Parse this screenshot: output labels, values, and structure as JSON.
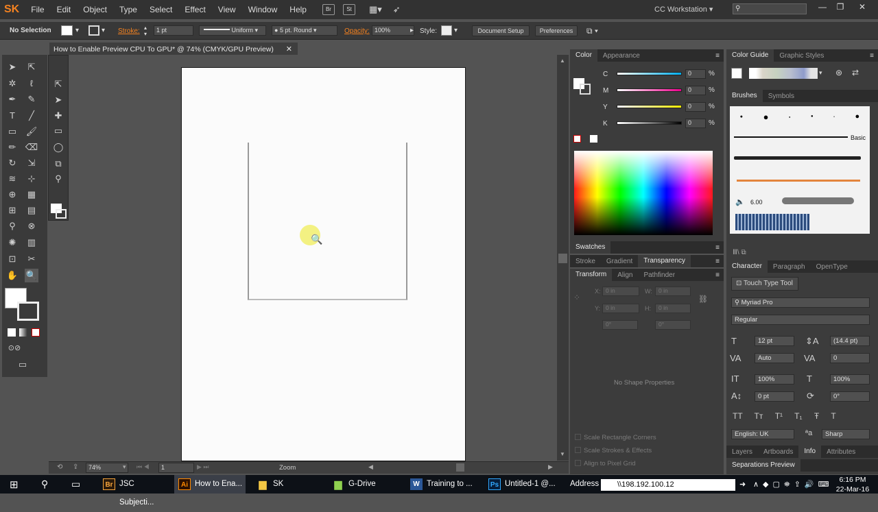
{
  "app": {
    "logo": "SK",
    "menu": [
      "File",
      "Edit",
      "Object",
      "Type",
      "Select",
      "Effect",
      "View",
      "Window",
      "Help"
    ],
    "bridge": "Br",
    "stock": "St",
    "workspace": "CC Workstation"
  },
  "control": {
    "selection": "No Selection",
    "stroke_label": "Stroke:",
    "stroke_weight": "1 pt",
    "profile": "Uniform",
    "brush": "5 pt. Round",
    "opacity_label": "Opacity:",
    "opacity": "100%",
    "style_label": "Style:",
    "doc_setup": "Document Setup",
    "preferences": "Preferences"
  },
  "document": {
    "tab_title": "How to Enable Preview CPU To GPU* @ 74% (CMYK/GPU Preview)",
    "zoom": "74%",
    "page": "1",
    "status": "Zoom"
  },
  "color_panel": {
    "tabs": [
      "Color",
      "Appearance"
    ],
    "channels": [
      {
        "name": "C",
        "value": "0"
      },
      {
        "name": "M",
        "value": "0"
      },
      {
        "name": "Y",
        "value": "0"
      },
      {
        "name": "K",
        "value": "0"
      }
    ],
    "pct": "%"
  },
  "swatches_panel": {
    "title": "Swatches"
  },
  "mid_tabs": [
    "Stroke",
    "Gradient",
    "Transparency"
  ],
  "transform_panel": {
    "tabs": [
      "Transform",
      "Align",
      "Pathfinder"
    ],
    "x_label": "X:",
    "x": "0 in",
    "w_label": "W:",
    "w": "0 in",
    "y_label": "Y:",
    "y": "0 in",
    "h_label": "H:",
    "h": "0 in",
    "rot": "0°",
    "shear": "0°",
    "empty": "No Shape Properties",
    "opts": [
      "Scale Rectangle Corners",
      "Scale Strokes & Effects",
      "Align to Pixel Grid"
    ]
  },
  "right_top": {
    "tabs": [
      "Color Guide",
      "Graphic Styles"
    ]
  },
  "brushes_panel": {
    "tabs": [
      "Brushes",
      "Symbols"
    ],
    "basic": "Basic",
    "size": "6.00"
  },
  "character_panel": {
    "tabs": [
      "Character",
      "Paragraph",
      "OpenType"
    ],
    "touch_tool": "Touch Type Tool",
    "font": "Myriad Pro",
    "style": "Regular",
    "size": "12 pt",
    "leading": "(14.4 pt)",
    "kerning": "Auto",
    "tracking": "0",
    "vscale": "100%",
    "hscale": "100%",
    "baseline": "0 pt",
    "rotation": "0°",
    "language": "English: UK",
    "aa": "Sharp"
  },
  "bottom_tabs": [
    "Layers",
    "Artboards",
    "Info",
    "Attributes"
  ],
  "sep_preview": "Separations Preview",
  "taskbar": {
    "items": [
      "JSC Subjecti...",
      "How to Ena...",
      "SK",
      "G-Drive",
      "Training to ...",
      "Untitled-1 @..."
    ],
    "address_label": "Address",
    "address": "\\\\198.192.100.12",
    "time": "6:16 PM",
    "date": "22-Mar-16"
  },
  "colors": {
    "accent": "#f58220",
    "panel": "#3c3c3c",
    "artboard": "#fbfbfb"
  }
}
